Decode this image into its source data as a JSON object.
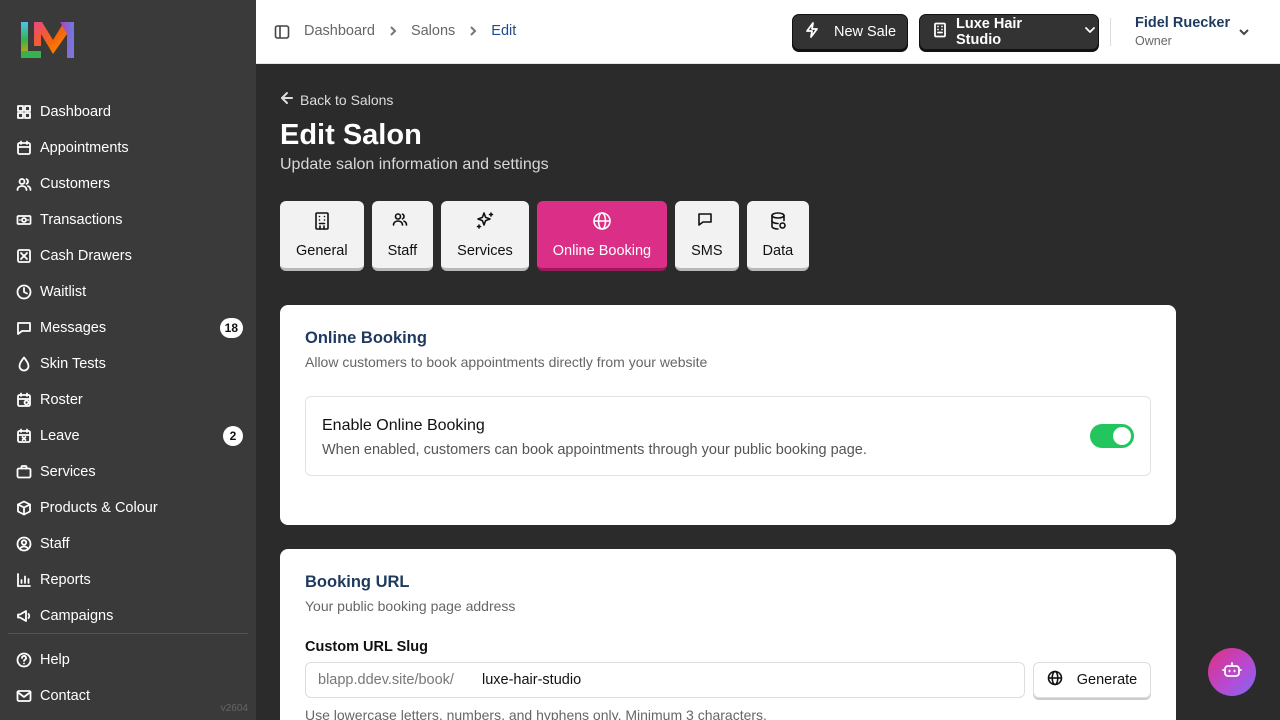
{
  "sidebar": {
    "nav": [
      {
        "label": "Dashboard",
        "icon": "dashboard-icon"
      },
      {
        "label": "Appointments",
        "icon": "calendar-icon"
      },
      {
        "label": "Customers",
        "icon": "users-icon"
      },
      {
        "label": "Transactions",
        "icon": "banknote-icon"
      },
      {
        "label": "Cash Drawers",
        "icon": "cash-drawer-icon"
      },
      {
        "label": "Waitlist",
        "icon": "clock-icon"
      },
      {
        "label": "Messages",
        "icon": "message-icon",
        "badge": "18"
      },
      {
        "label": "Skin Tests",
        "icon": "droplet-icon"
      },
      {
        "label": "Roster",
        "icon": "calendar-clock-icon"
      },
      {
        "label": "Leave",
        "icon": "calendar-x-icon",
        "badge": "2"
      },
      {
        "label": "Services",
        "icon": "briefcase-icon"
      },
      {
        "label": "Products & Colour",
        "icon": "package-icon"
      },
      {
        "label": "Staff",
        "icon": "user-circle-icon"
      },
      {
        "label": "Reports",
        "icon": "bar-chart-icon"
      },
      {
        "label": "Campaigns",
        "icon": "megaphone-icon"
      }
    ],
    "bottom": [
      {
        "label": "Help",
        "icon": "help-circle-icon"
      },
      {
        "label": "Contact",
        "icon": "mail-icon"
      }
    ],
    "version": "v2604"
  },
  "header": {
    "breadcrumb": [
      "Dashboard",
      "Salons",
      "Edit"
    ],
    "new_sale_label": "New Sale",
    "salon_label": "Luxe Hair Studio",
    "user_name": "Fidel Ruecker",
    "user_role": "Owner"
  },
  "page": {
    "back_label": "Back to Salons",
    "title": "Edit Salon",
    "subtitle": "Update salon information and settings",
    "tabs": [
      {
        "label": "General",
        "icon": "building-icon"
      },
      {
        "label": "Staff",
        "icon": "users-icon"
      },
      {
        "label": "Services",
        "icon": "sparkles-icon"
      },
      {
        "label": "Online Booking",
        "icon": "globe-icon",
        "active": true
      },
      {
        "label": "SMS",
        "icon": "message-icon"
      },
      {
        "label": "Data",
        "icon": "database-icon"
      }
    ]
  },
  "online_booking": {
    "title": "Online Booking",
    "subtitle": "Allow customers to book appointments directly from your website",
    "toggle_title": "Enable Online Booking",
    "toggle_desc": "When enabled, customers can book appointments through your public booking page.",
    "enabled": true
  },
  "booking_url": {
    "title": "Booking URL",
    "subtitle": "Your public booking page address",
    "field_label": "Custom URL Slug",
    "prefix": "blapp.ddev.site/book/",
    "value": "luxe-hair-studio",
    "generate_label": "Generate",
    "hint": "Use lowercase letters, numbers, and hyphens only. Minimum 3 characters."
  },
  "colors": {
    "accent": "#db2f87",
    "toggle_on": "#22c55e",
    "sidebar_bg": "#3a3a3a",
    "main_bg": "#2b2b2b"
  }
}
